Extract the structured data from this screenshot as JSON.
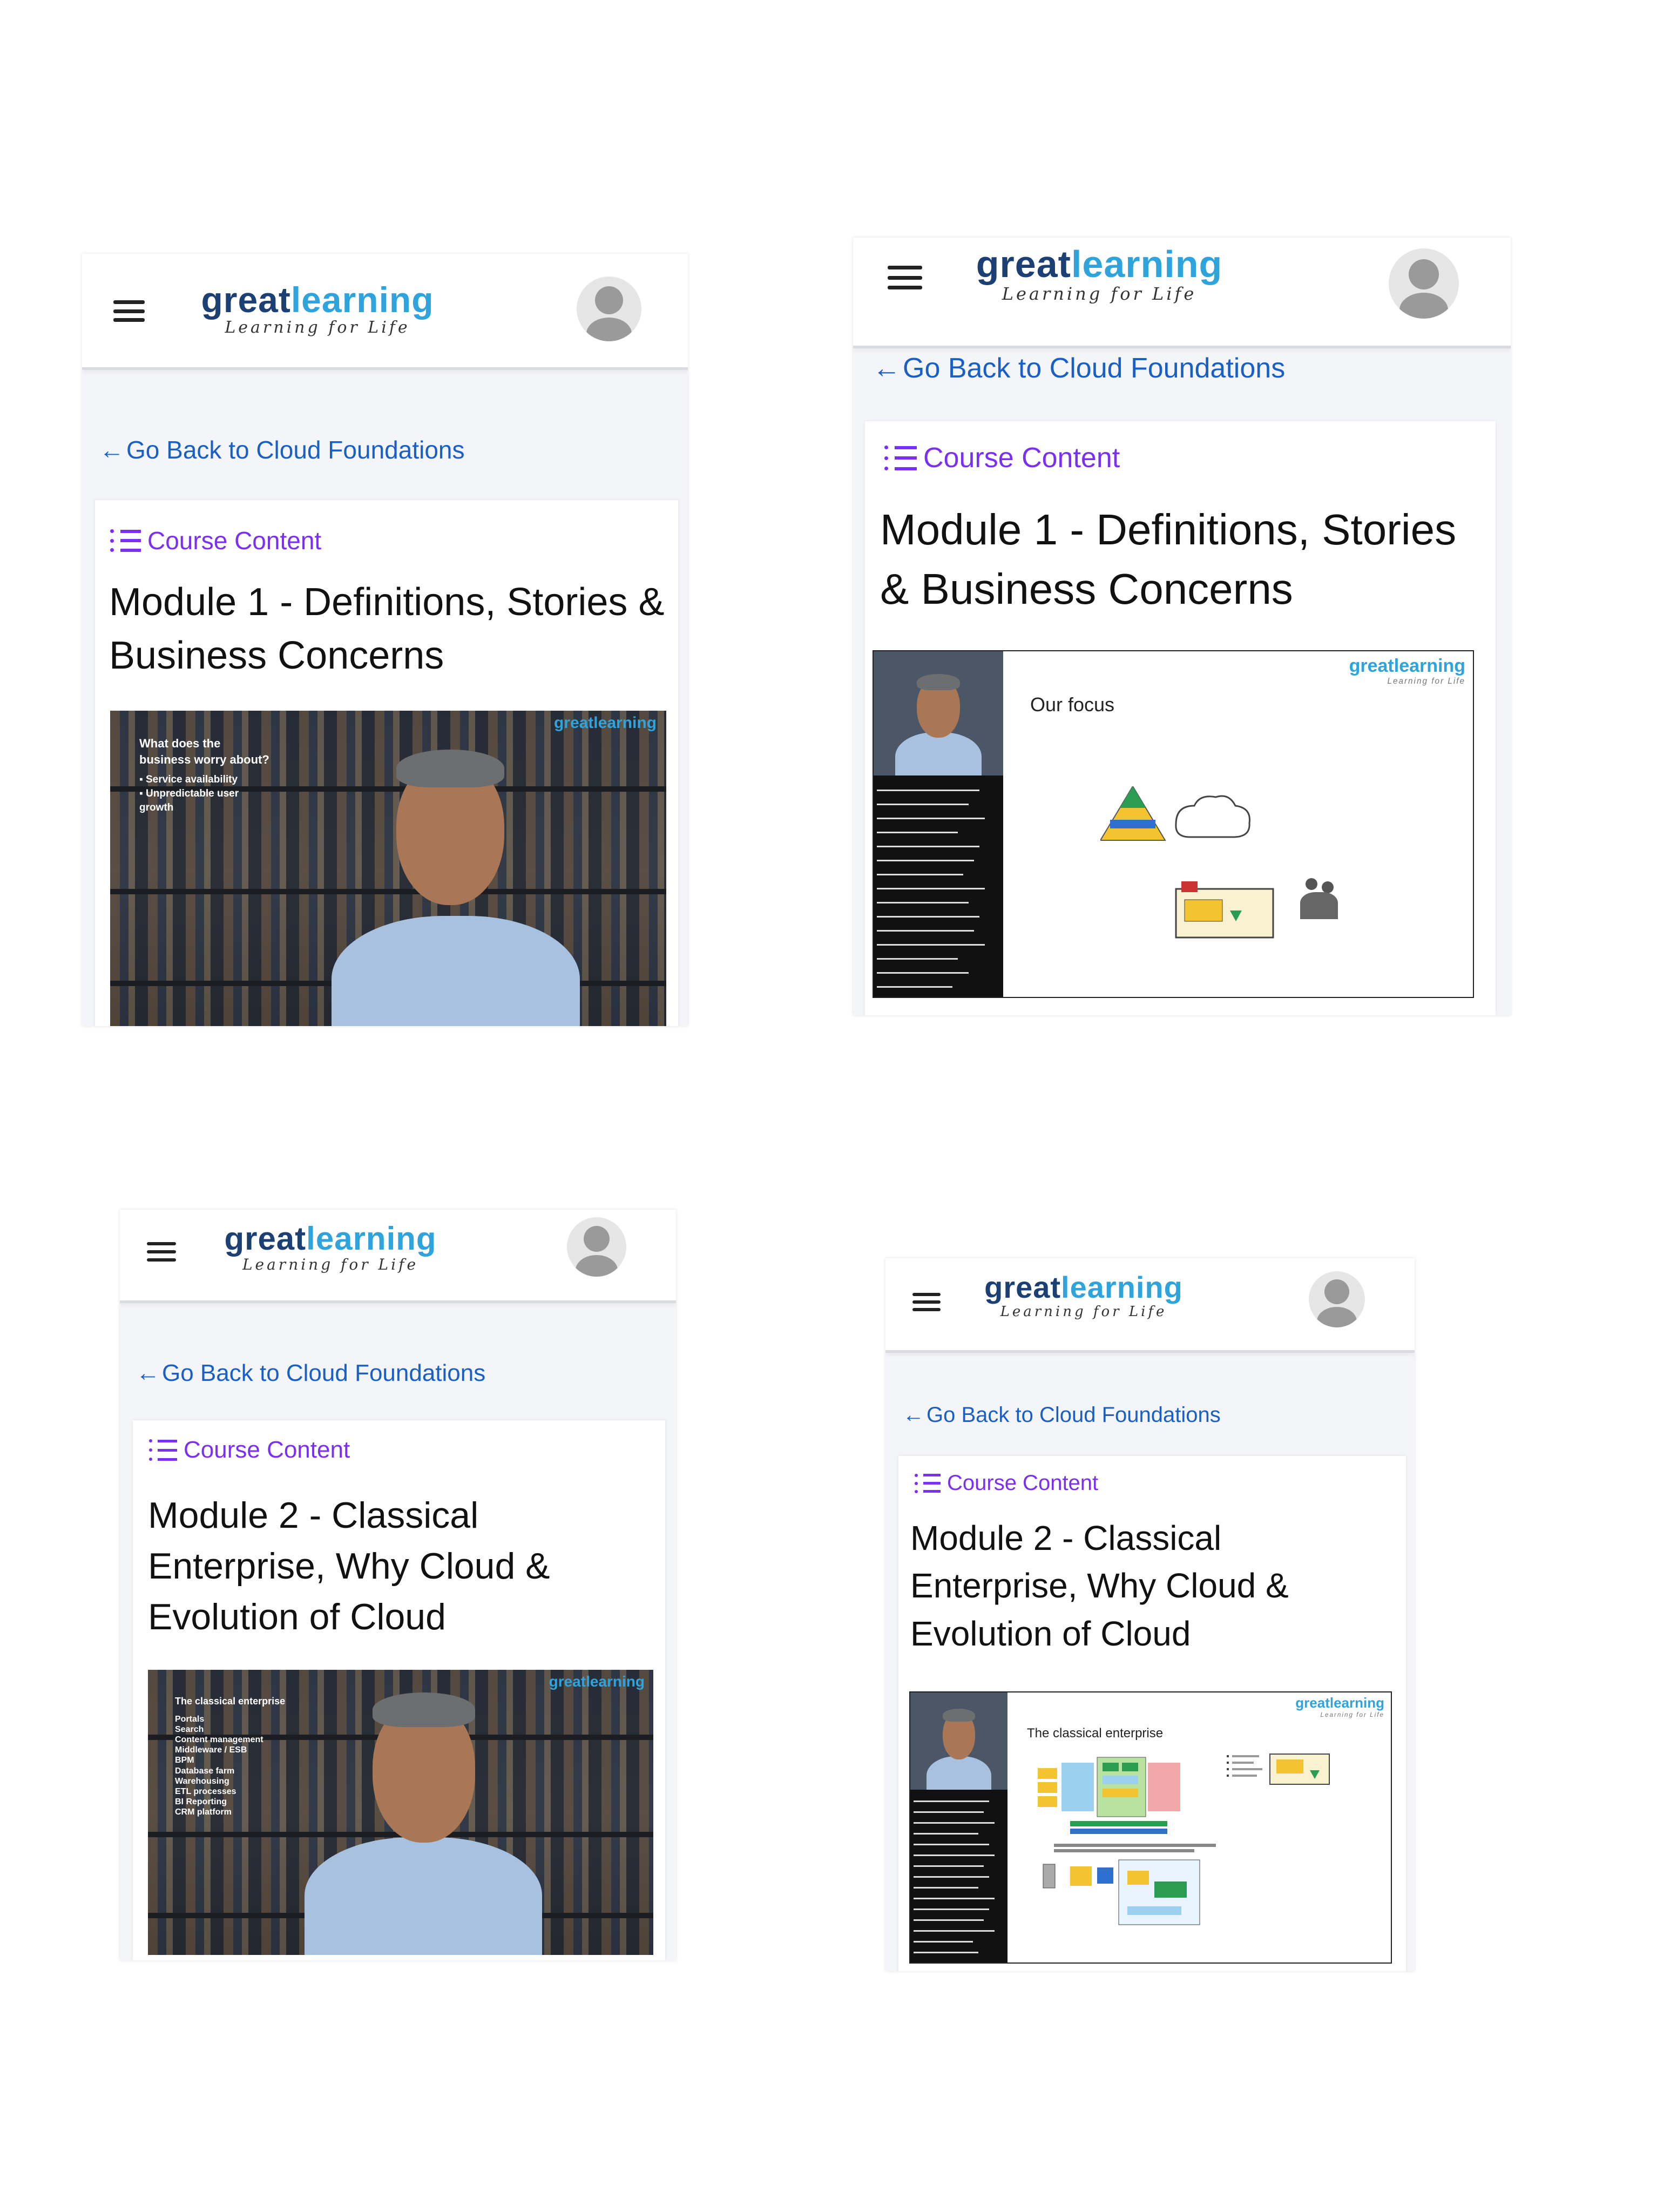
{
  "colors": {
    "brand_dark": "#1c3f74",
    "brand_light": "#2fa3dc",
    "link": "#1a5fc4",
    "course_content": "#7b2ff0"
  },
  "screenshots": [
    {
      "logo": {
        "great": "great",
        "learning": "learning",
        "tagline": "Learning for Life"
      },
      "back_link": "Go Back to Cloud Foundations",
      "course_content": "Course Content",
      "module_title": "Module 1 - Definitions, Stories & Business Concerns",
      "video": {
        "watermark": "greatlearning",
        "overlay_lines": [
          "What does the",
          "business worry about?",
          "▪ Service availability",
          "▪ Unpredictable user",
          "  growth"
        ]
      }
    },
    {
      "logo": {
        "great": "great",
        "learning": "learning",
        "tagline": "Learning for Life"
      },
      "back_link": "Go Back to Cloud Foundations",
      "course_content": "Course Content",
      "module_title": "Module 1 - Definitions, Stories & Business Concerns",
      "slide": {
        "title": "Our focus",
        "watermark": "greatlearning",
        "watermark_tagline": "Learning for Life"
      }
    },
    {
      "logo": {
        "great": "great",
        "learning": "learning",
        "tagline": "Learning for Life"
      },
      "back_link": "Go Back to Cloud Foundations",
      "course_content": "Course Content",
      "module_title": "Module 2 - Classical Enterprise, Why Cloud & Evolution of Cloud",
      "video": {
        "watermark": "greatlearning",
        "overlay_lines": [
          "The classical enterprise",
          "Portals",
          "Search",
          "Content management",
          "Middleware / ESB",
          "BPM",
          "Database farm",
          "Warehousing",
          "ETL processes",
          "BI Reporting",
          "CRM platform"
        ]
      }
    },
    {
      "logo": {
        "great": "great",
        "learning": "learning",
        "tagline": "Learning for Life"
      },
      "back_link": "Go Back to Cloud Foundations",
      "course_content": "Course Content",
      "module_title": "Module 2 - Classical Enterprise, Why Cloud & Evolution of Cloud",
      "slide": {
        "title": "The classical enterprise",
        "watermark": "greatlearning",
        "watermark_tagline": "Learning for Life"
      }
    }
  ]
}
